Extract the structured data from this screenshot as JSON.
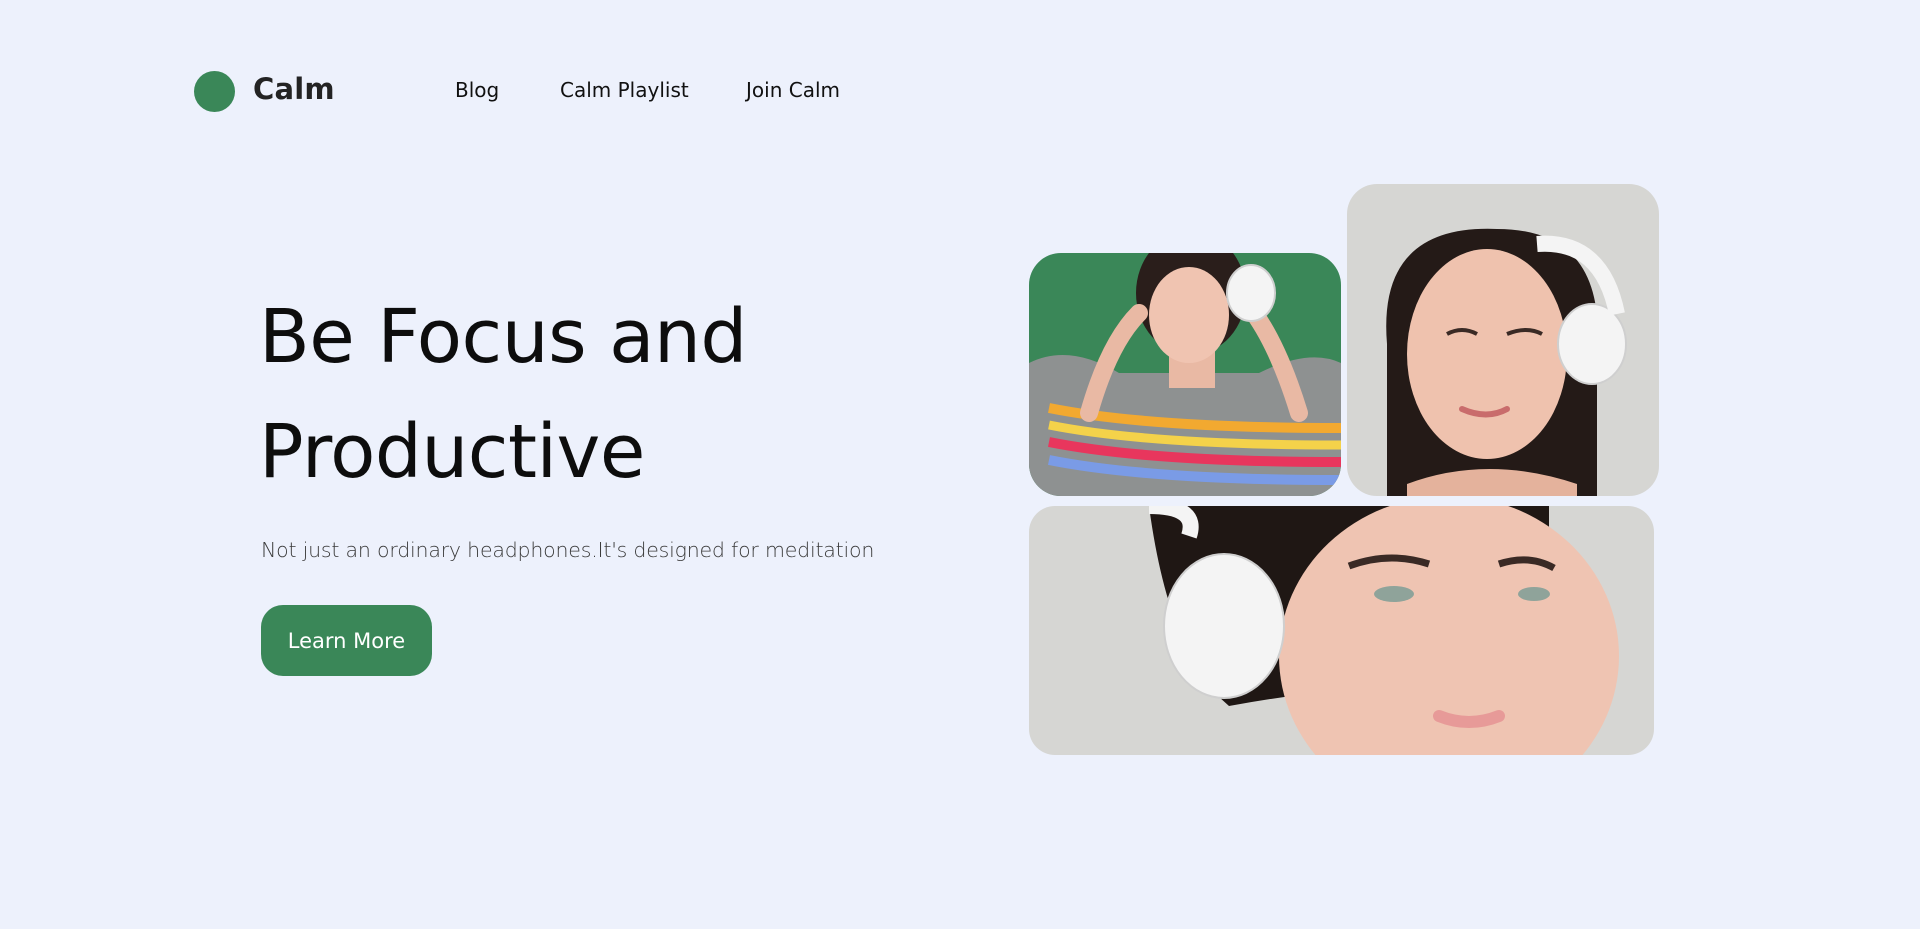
{
  "brand": {
    "name": "Calm",
    "accent": "#3a8758"
  },
  "nav": {
    "items": [
      {
        "label": "Blog"
      },
      {
        "label": "Calm Playlist"
      },
      {
        "label": "Join Calm"
      }
    ]
  },
  "hero": {
    "title_line1": "Be Focus and",
    "title_line2": "Productive",
    "subtitle": "Not just an ordinary headphones.It's designed for meditation",
    "cta_label": "Learn More"
  },
  "colors": {
    "background": "#edf1fc",
    "accent": "#3a8758",
    "photo_backdrop": "#d6d6d3"
  }
}
